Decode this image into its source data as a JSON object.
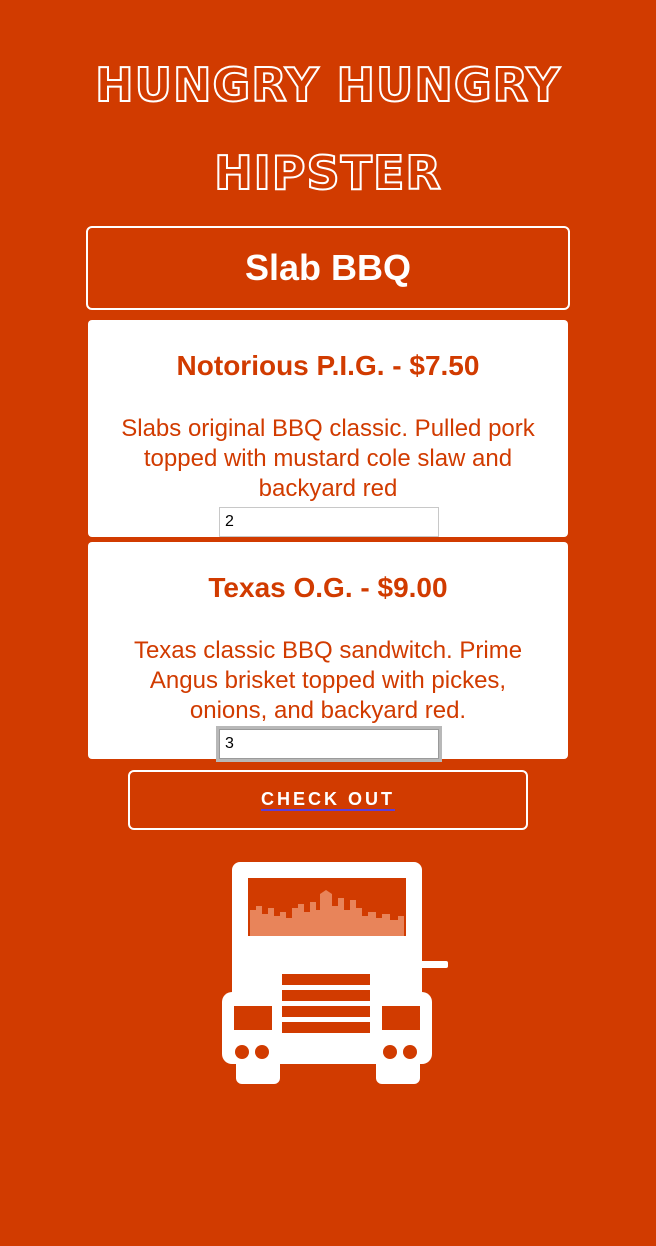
{
  "header": {
    "title_line_1": "HUNGRY HUNGRY",
    "title_line_2": "HIPSTER"
  },
  "vendor": {
    "name": "Slab BBQ"
  },
  "menu_items": [
    {
      "heading": "Notorious P.I.G. - $7.50",
      "description": "Slabs original BBQ classic. Pulled pork topped with mustard cole slaw and backyard red",
      "quantity": "2"
    },
    {
      "heading": "Texas O.G. - $9.00",
      "description": "Texas classic BBQ sandwitch. Prime Angus brisket topped with pickes, onions, and backyard red.",
      "quantity": "3"
    }
  ],
  "checkout": {
    "label": "CHECK OUT"
  },
  "colors": {
    "background": "#d13b00",
    "card": "#ffffff",
    "accent_link": "#5b3fd8"
  },
  "icons": {
    "truck": "food-truck-icon"
  }
}
